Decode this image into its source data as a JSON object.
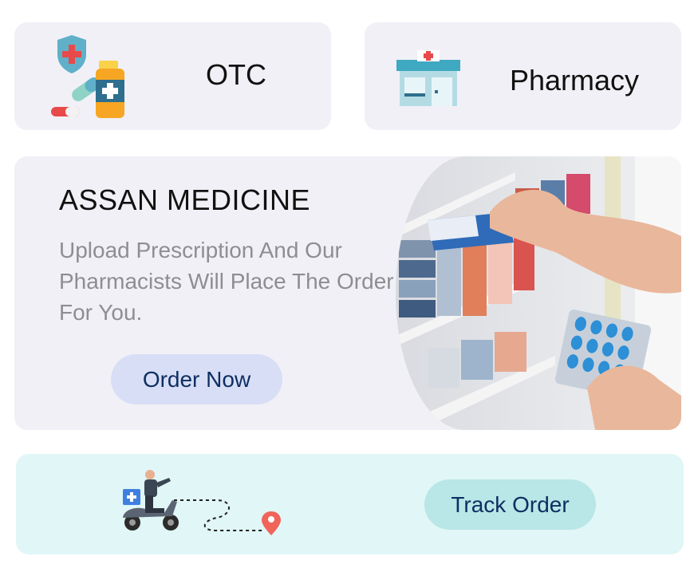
{
  "otc": {
    "label": "OTC",
    "icon": "medicine-icon"
  },
  "pharmacy": {
    "label": "Pharmacy",
    "icon": "pharmacy-store-icon"
  },
  "promo": {
    "title": "ASSAN MEDICINE",
    "description": "Upload Prescription And Our Pharmacists Will Place The Order For You.",
    "button_label": "Order Now",
    "image": "pharmacist-shelf-photo"
  },
  "tracking": {
    "button_label": "Track Order",
    "illustration": "delivery-scooter-route-illustration"
  },
  "colors": {
    "card_bg": "#f1f0f6",
    "track_bg": "#e0f6f7",
    "order_button": "#d8def5",
    "track_button": "#b9e6e6",
    "button_text": "#0e2f63"
  }
}
